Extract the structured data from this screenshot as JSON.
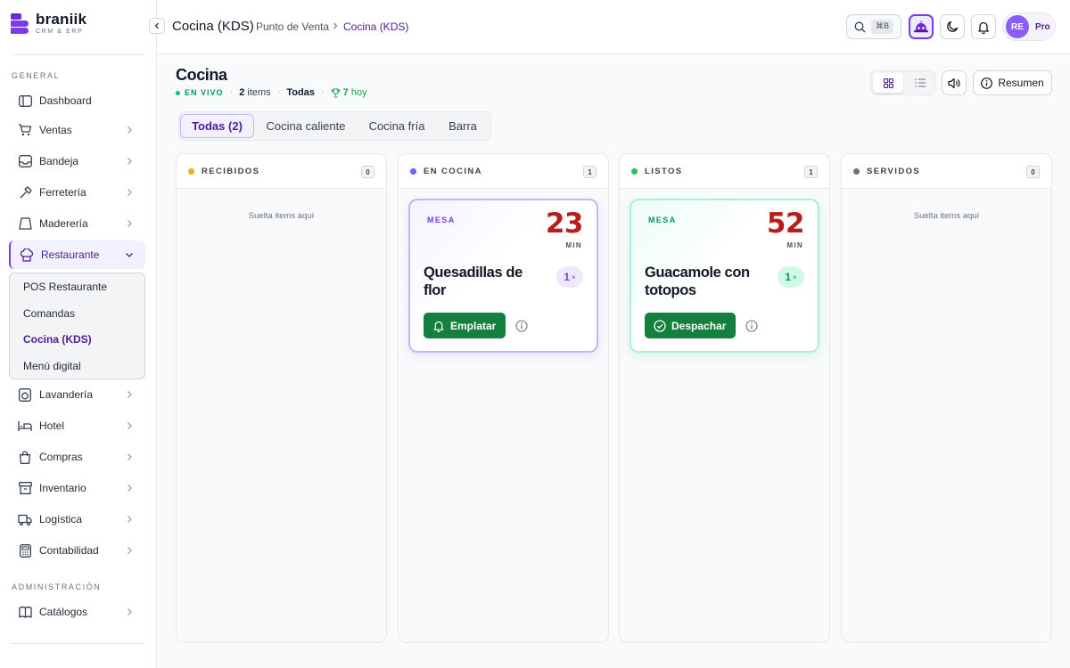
{
  "brand": {
    "name": "braniik",
    "subtitle": "CRM & ERP"
  },
  "sidebar": {
    "sections": {
      "general": "GENERAL",
      "admin": "ADMINISTRACIÓN"
    },
    "items": [
      {
        "label": "Dashboard",
        "icon": "dashboard-icon"
      },
      {
        "label": "Ventas",
        "icon": "cart-icon"
      },
      {
        "label": "Bandeja",
        "icon": "inbox-icon"
      },
      {
        "label": "Ferretería",
        "icon": "hammer-icon"
      },
      {
        "label": "Maderería",
        "icon": "wood-icon"
      },
      {
        "label": "Restaurante",
        "icon": "chef-hat-icon"
      },
      {
        "label": "Lavandería",
        "icon": "laundry-icon"
      },
      {
        "label": "Hotel",
        "icon": "bed-icon"
      },
      {
        "label": "Compras",
        "icon": "bag-icon"
      },
      {
        "label": "Inventario",
        "icon": "package-icon"
      },
      {
        "label": "Logística",
        "icon": "truck-icon"
      },
      {
        "label": "Contabilidad",
        "icon": "calculator-icon"
      },
      {
        "label": "Catálogos",
        "icon": "book-icon"
      }
    ],
    "restaurant_submenu": [
      "POS Restaurante",
      "Comandas",
      "Cocina (KDS)",
      "Menú digital"
    ]
  },
  "header": {
    "title": "Cocina (KDS)",
    "breadcrumb": [
      "Punto de Venta",
      "Cocina (KDS)"
    ],
    "search_shortcut": "⌘B",
    "user_initials": "RE",
    "plan": "Pro"
  },
  "kitchen": {
    "title": "Cocina",
    "live": "EN VIVO",
    "items_count": "2",
    "items_label": "items",
    "filter": "Todas",
    "today_count": "7",
    "today_label": "hoy",
    "summary_label": "Resumen"
  },
  "tabs": [
    "Todas (2)",
    "Cocina caliente",
    "Cocina fría",
    "Barra"
  ],
  "columns": [
    {
      "title": "RECIBIDOS",
      "count": "0",
      "dot": "#eab308",
      "empty": "Suelta items aquí"
    },
    {
      "title": "EN COCINA",
      "count": "1",
      "dot": "#6366f1"
    },
    {
      "title": "LISTOS",
      "count": "1",
      "dot": "#22c55e"
    },
    {
      "title": "SERVIDOS",
      "count": "0",
      "dot": "#6b7280",
      "empty": "Suelta items aquí"
    }
  ],
  "tickets": [
    {
      "table": "MESA",
      "minutes": "23",
      "min_label": "MIN",
      "name": "Quesadillas de flor",
      "qty": "1",
      "qty_suffix": "×",
      "action": "Emplatar"
    },
    {
      "table": "MESA",
      "minutes": "52",
      "min_label": "MIN",
      "name": "Guacamole con totopos",
      "qty": "1",
      "qty_suffix": "×",
      "action": "Despachar"
    }
  ],
  "colors": {
    "accent": "#7c3aed",
    "success": "#15803d",
    "timer": "#b91c1c"
  }
}
